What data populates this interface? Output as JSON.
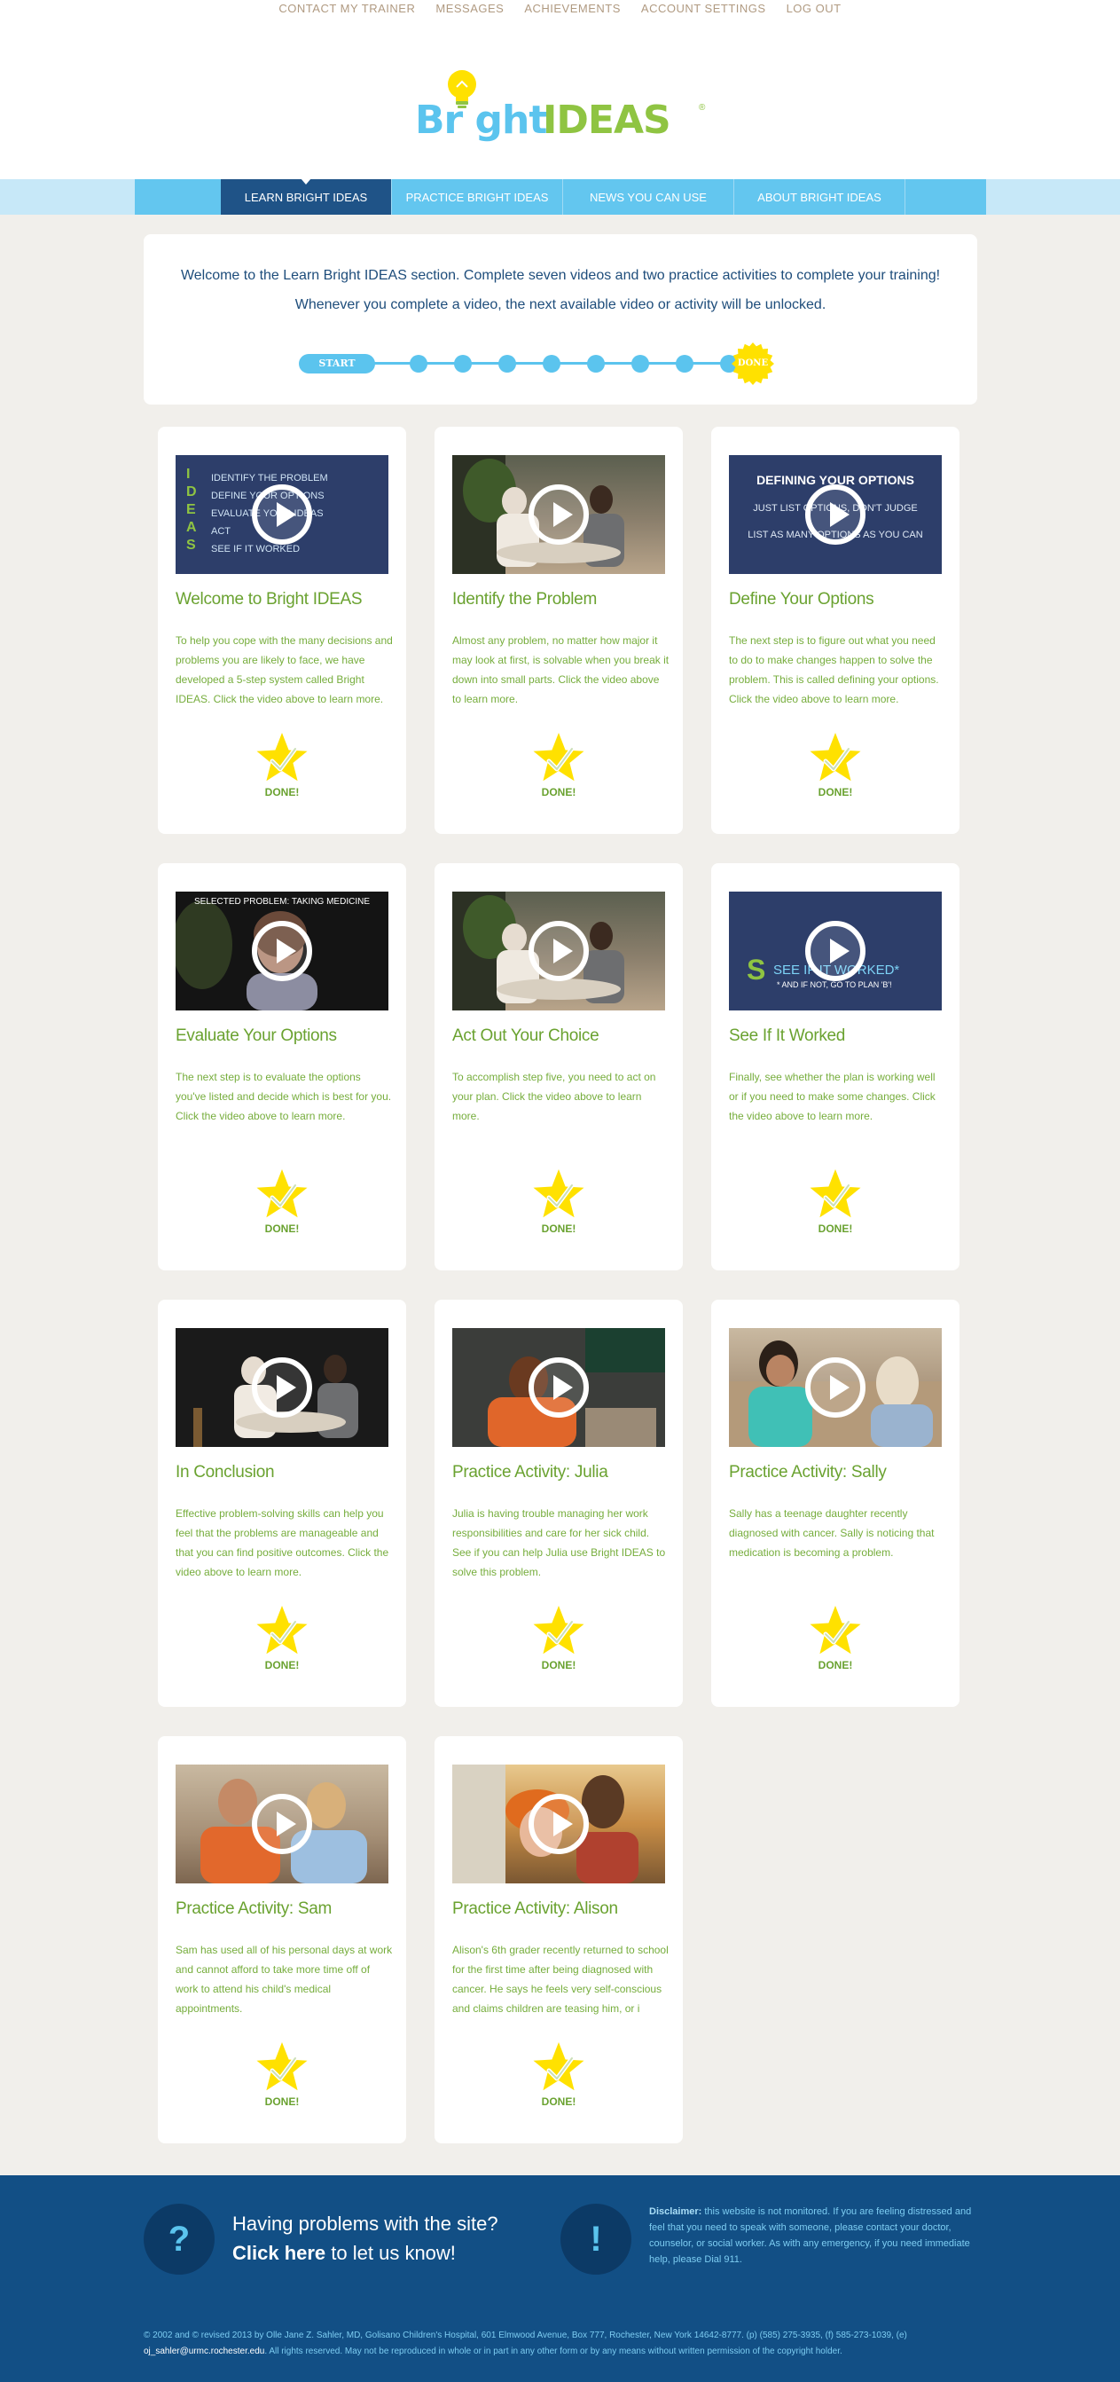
{
  "top_menu": {
    "items": [
      "CONTACT MY TRAINER",
      "MESSAGES",
      "ACHIEVEMENTS",
      "ACCOUNT SETTINGS",
      "LOG OUT"
    ]
  },
  "logo": {
    "bright": "Br ght",
    "ideas": "IDEAS",
    "tm": "®"
  },
  "nav": {
    "tabs": [
      "LEARN BRIGHT IDEAS",
      "PRACTICE BRIGHT IDEAS",
      "NEWS YOU CAN USE",
      "ABOUT BRIGHT IDEAS"
    ],
    "active": 0
  },
  "intro": {
    "text": "Welcome to the Learn Bright IDEAS section. Complete seven videos and two practice activities to complete your training! Whenever you complete a video, the next available video or activity will be unlocked.",
    "start_label": "START",
    "done_label": "DONE",
    "steps": 8
  },
  "cards": [
    {
      "title": "Welcome to Bright IDEAS",
      "desc": "To help you cope with the many decisions and problems you are likely to face, we have developed a 5-step system called Bright IDEAS. Click the video above to learn more.",
      "badge": "DONE!",
      "thumb_lines": [
        "IDENTIFY THE PROBLEM",
        "DEFINE YOUR OPTIONS",
        "EVALUATE YOUR IDEAS",
        "ACT",
        "SEE IF IT WORKED"
      ],
      "thumb_letters": [
        "I",
        "D",
        "E",
        "A",
        "S"
      ]
    },
    {
      "title": "Identify the Problem",
      "desc": "Almost any problem, no matter how major it may look at first, is solvable when you break it down into small parts. Click the video above to learn more.",
      "badge": "DONE!"
    },
    {
      "title": "Define Your Options",
      "desc": "The next step is to figure out what you need to do to make changes happen to solve the problem. This is called defining your options. Click the video above to learn more.",
      "badge": "DONE!",
      "thumb_heading": "DEFINING YOUR OPTIONS",
      "thumb_sub1": "JUST LIST OPTIONS, DON'T JUDGE",
      "thumb_sub2": "LIST AS MANY OPTIONS AS YOU CAN"
    },
    {
      "title": "Evaluate Your Options",
      "desc": "The next step is to evaluate the options you've listed and decide which is best for you. Click the video above to learn more.",
      "badge": "DONE!",
      "thumb_caption": "SELECTED PROBLEM: TAKING MEDICINE"
    },
    {
      "title": "Act Out Your Choice",
      "desc": "To accomplish step five, you need to act on your plan. Click the video above to learn more.",
      "badge": "DONE!"
    },
    {
      "title": "See If It Worked",
      "desc": "Finally, see whether the plan is working well or if you need to make some changes. Click the video above to learn more.",
      "badge": "DONE!",
      "thumb_letter": "S",
      "thumb_line1": "SEE IF IT WORKED*",
      "thumb_line2": "* AND IF NOT, GO TO PLAN 'B'!"
    },
    {
      "title": "In Conclusion",
      "desc": "Effective problem-solving skills can help you feel that the problems are manageable and that you can find positive outcomes. Click the video above to learn more.",
      "badge": "DONE!"
    },
    {
      "title": "Practice Activity: Julia",
      "desc": "Julia is having trouble managing her work responsibilities and care for her sick child. See if you can help Julia use Bright IDEAS to solve this problem.",
      "badge": "DONE!"
    },
    {
      "title": "Practice Activity: Sally",
      "desc": "Sally has a teenage daughter recently diagnosed with cancer. Sally is noticing that medication is becoming a problem.",
      "badge": "DONE!"
    },
    {
      "title": "Practice Activity: Sam",
      "desc": "Sam has used all of his personal days at work and cannot afford to take more time off of work to attend his child's medical appointments.",
      "badge": "DONE!"
    },
    {
      "title": "Practice Activity: Alison",
      "desc": "Alison's 6th grader recently returned to school for the first time after being diagnosed with cancer. He says he feels very self-conscious and claims children are teasing him, or i",
      "badge": "DONE!"
    }
  ],
  "footer": {
    "help_icon": "?",
    "help_line1": "Having problems with the site?",
    "help_link": "Click here",
    "help_line2_rest": " to let us know!",
    "warn_icon": "!",
    "disclaimer_label": "Disclaimer:",
    "disclaimer_text": " this website is not monitored. If you are feeling distressed and feel that you need to speak with someone, please contact your doctor, counselor, or social worker. As with any emergency, if you need immediate help, please Dial 911.",
    "copyright_text": "© 2002 and © revised 2013 by Olle Jane Z. Sahler, MD, Golisano Children's Hospital, 601 Elmwood Avenue, Box 777, Rochester, New York 14642-8777. (p) (585) 275-3935, (f) 585-273-1039, (e) ",
    "copyright_email": "oj_sahler@urmc.rochester.edu",
    "copyright_tail": ". All rights reserved. May not be reproduced in whole or in part in any other form or by any means without written permission of the copyright holder."
  },
  "colors": {
    "nav_bg": "#63c6ef",
    "nav_active": "#1f5387",
    "title_green": "#6aa230",
    "badge_yellow": "#ffe100",
    "footer_bg": "#124f85"
  }
}
